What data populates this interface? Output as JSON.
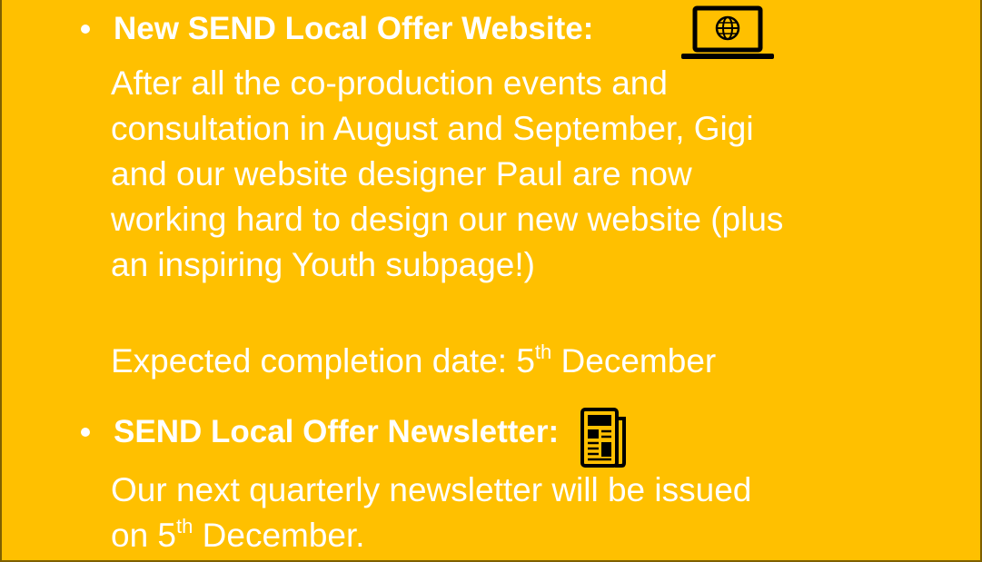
{
  "sections": [
    {
      "heading": "New SEND Local Offer Website:",
      "icon": "laptop-globe-icon",
      "paragraph_lines": [
        "After all the co-production events and",
        "consultation in August and September, Gigi",
        "and our website designer Paul are now",
        "working hard to design our new website (plus",
        "an inspiring Youth subpage!)"
      ],
      "date_line": {
        "prefix": "Expected completion date: 5",
        "sup": "th",
        "suffix": " December"
      }
    },
    {
      "heading": "SEND Local Offer Newsletter:",
      "icon": "newspaper-icon",
      "line1": "Our next quarterly newsletter will be issued",
      "line2": {
        "prefix": "on 5",
        "sup": "th",
        "suffix": " December."
      }
    }
  ],
  "colors": {
    "background": "#FFC000",
    "text": "#FFFFFF",
    "icon": "#000000",
    "border": "#7F6000"
  }
}
